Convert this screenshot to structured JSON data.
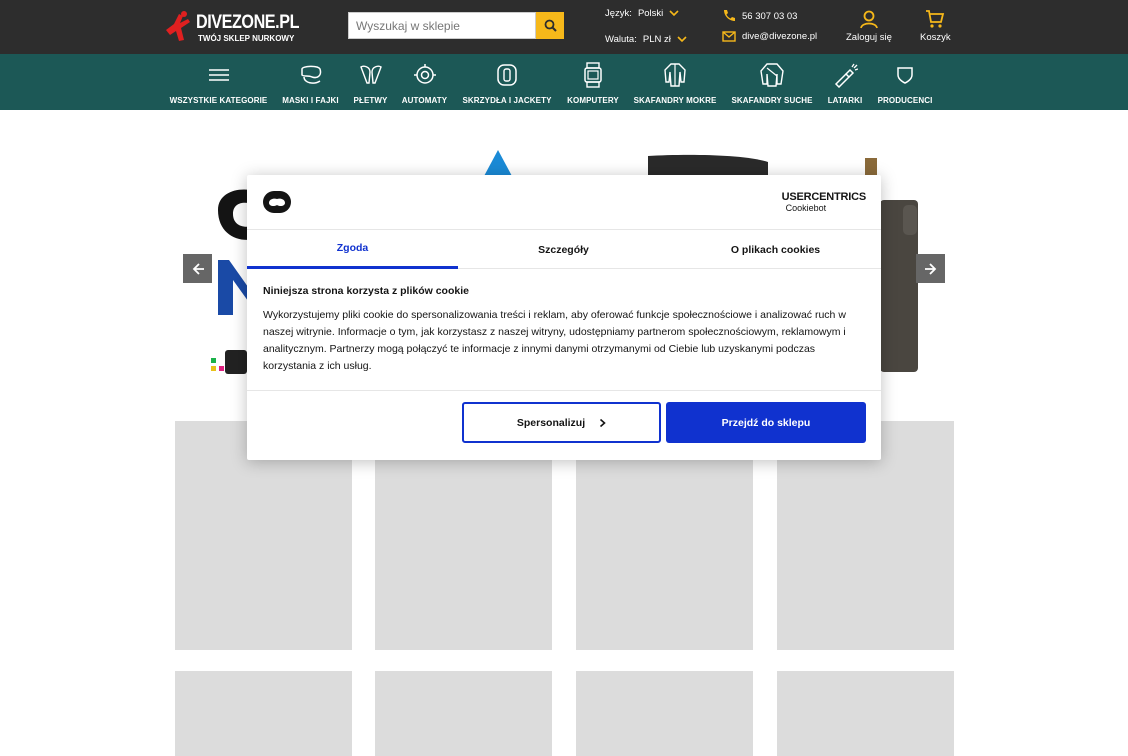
{
  "header": {
    "logo_brand": "DIVEZONE.PL",
    "logo_tagline": "TWÓJ SKLEP NURKOWY",
    "search_placeholder": "Wyszukaj w sklepie",
    "language_label": "Język:",
    "language_value": "Polski",
    "currency_label": "Waluta:",
    "currency_value": "PLN zł",
    "phone": "56 307 03 03",
    "email": "dive@divezone.pl",
    "login_label": "Zaloguj się",
    "cart_label": "Koszyk",
    "accent_color": "#f6b81a"
  },
  "nav": {
    "items": [
      {
        "label": "WSZYSTKIE KATEGORIE",
        "icon": "hamburger-icon"
      },
      {
        "label": "MASKI I FAJKI",
        "icon": "mask-icon"
      },
      {
        "label": "PŁETWY",
        "icon": "fins-icon"
      },
      {
        "label": "AUTOMATY",
        "icon": "regulator-icon"
      },
      {
        "label": "SKRZYDŁA I JACKETY",
        "icon": "bcd-icon"
      },
      {
        "label": "KOMPUTERY",
        "icon": "dive-computer-icon"
      },
      {
        "label": "SKAFANDRY MOKRE",
        "icon": "wetsuit-icon"
      },
      {
        "label": "SKAFANDRY SUCHE",
        "icon": "drysuit-icon"
      },
      {
        "label": "LATARKI",
        "icon": "flashlight-icon"
      },
      {
        "label": "PRODUCENCI",
        "icon": "shield-icon"
      }
    ]
  },
  "cookie_modal": {
    "brand_line1": "USERCENTRICS",
    "brand_line2": "Cookiebot",
    "tabs": [
      "Zgoda",
      "Szczegóły",
      "O plikach cookies"
    ],
    "title": "Niniejsza strona korzysta z plików cookie",
    "text": "Wykorzystujemy pliki cookie do spersonalizowania treści i reklam, aby oferować funkcje społecznościowe i analizować ruch w naszej witrynie. Informacje o tym, jak korzystasz z naszej witryny, udostępniamy partnerom społecznościowym, reklamowym i analitycznym. Partnerzy mogą połączyć te informacje z innymi danymi otrzymanymi od Ciebie lub uzyskanymi podczas korzystania z ich usług.",
    "customize_label": "Spersonalizuj",
    "accept_label": "Przejdź do sklepu",
    "primary_color": "#1032cf"
  },
  "colors": {
    "topbar": "#2d2d2d",
    "navbar": "#1c5856",
    "tile": "#dcdcdc"
  }
}
